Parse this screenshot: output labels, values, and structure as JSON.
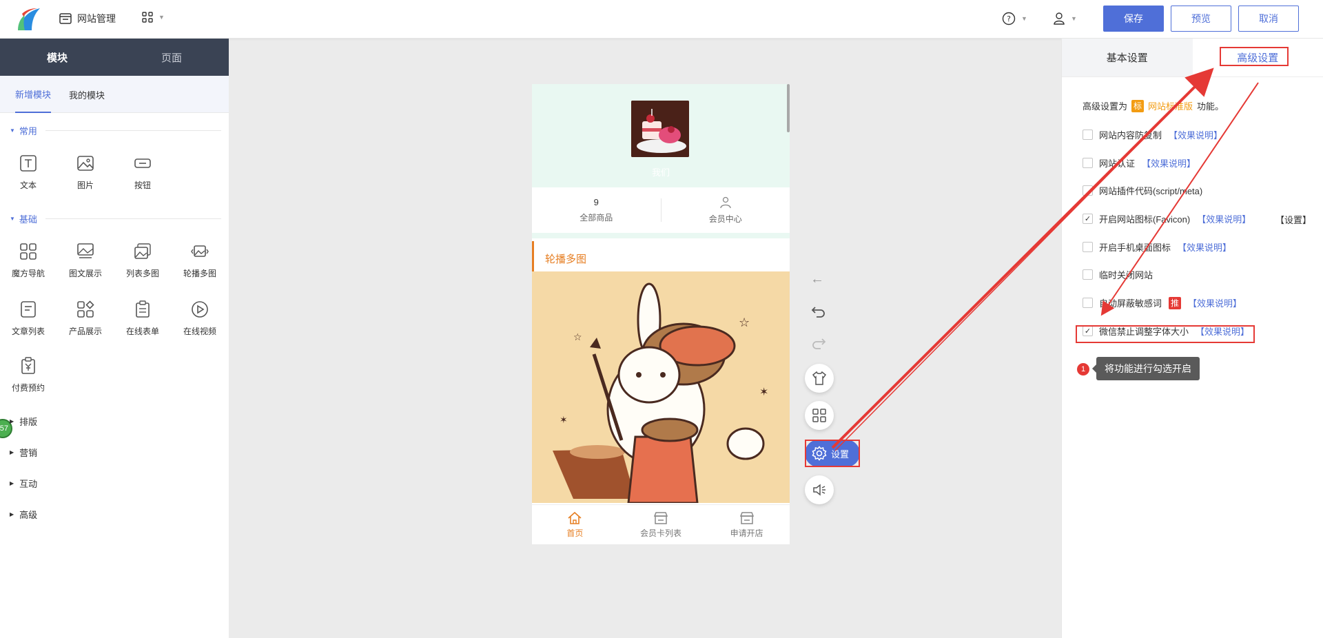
{
  "topbar": {
    "site_manage": "网站管理",
    "buttons": {
      "save": "保存",
      "preview": "预览",
      "cancel": "取消"
    }
  },
  "sidebar": {
    "tabs": [
      "模块",
      "页面"
    ],
    "subtabs": [
      "新增模块",
      "我的模块"
    ],
    "sections": {
      "common": "常用",
      "basic": "基础",
      "layout": "排版",
      "marketing": "营销",
      "interact": "互动",
      "advanced": "高级"
    },
    "common_modules": [
      "文本",
      "图片",
      "按钮"
    ],
    "basic_modules": [
      "魔方导航",
      "图文展示",
      "列表多图",
      "轮播多图",
      "文章列表",
      "产品展示",
      "在线表单",
      "在线视频",
      "付费预约"
    ],
    "badge": "57"
  },
  "phone": {
    "avatar_name": "我们",
    "stats": [
      {
        "num": "9",
        "label": "全部商品"
      },
      {
        "label": "会员中心"
      }
    ],
    "carousel_title": "轮播多图",
    "nav": [
      "首页",
      "会员卡列表",
      "申请开店"
    ]
  },
  "tools": {
    "setting_label": "设置"
  },
  "right_panel": {
    "tabs": [
      "基本设置",
      "高级设置"
    ],
    "note_prefix": "高级设置为",
    "note_tag": "标",
    "note_link": "网站标准版",
    "note_suffix": "功能。",
    "options": [
      {
        "label": "网站内容防复制",
        "link": "【效果说明】",
        "checked": false
      },
      {
        "label": "网站认证",
        "link": "【效果说明】",
        "checked": false
      },
      {
        "label": "网站插件代码(script/meta)",
        "checked": false
      },
      {
        "label": "开启网站图标(Favicon)",
        "link": "【效果说明】",
        "checked": true,
        "extra": "【设置】"
      },
      {
        "label": "开启手机桌面图标",
        "link": "【效果说明】",
        "checked": false
      },
      {
        "label": "临时关闭网站",
        "checked": false
      },
      {
        "label": "自动屏蔽敏感词",
        "tag": "推",
        "link": "【效果说明】",
        "checked": false
      },
      {
        "label": "微信禁止调整字体大小",
        "link": "【效果说明】",
        "checked": true
      }
    ],
    "tip_number": "1",
    "tip_text": "将功能进行勾选开启"
  },
  "colors": {
    "primary": "#4f6fd8",
    "annotation_red": "#e53935",
    "orange": "#e67e22",
    "sidebar_dark": "#3a4354"
  }
}
